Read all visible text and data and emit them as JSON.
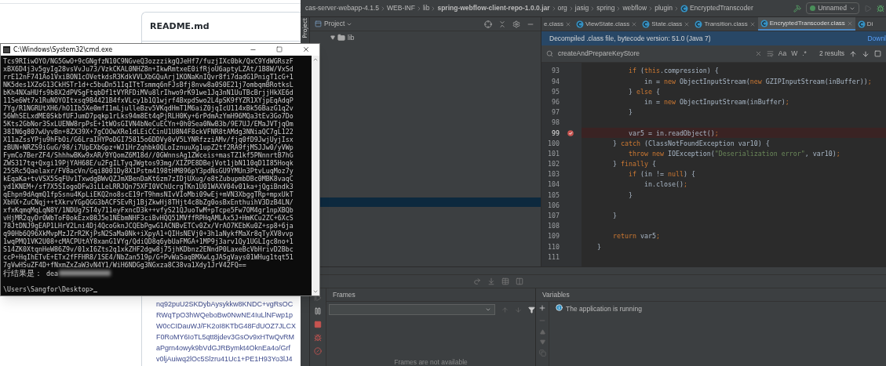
{
  "browser": {
    "file_title": "README.md",
    "content_lines": [
      "nq92puU2SKDybAysykkw8KNDC+vgRsOC",
      "RWqTpO3hWQeboBw0NwNE4IuLlNFwp1p",
      "W0cCIDauWJ/FK2oI8KTbG48FdUOZ7JLCX",
      "F0RoMY6IoTL5qtt8jdev3GsOv9xHTwQvRM",
      "aPgrn4owyk9bVdGJRBymkt4OknEa4o/Grf",
      "v0ljAuiwq2lOc5Slzru41Uc1+PE1H93Yo3lJ4"
    ]
  },
  "cmd": {
    "title": "C:\\Windows\\System32\\cmd.exe",
    "output_lines": [
      "Tcs9RIiwOYO/NG5GwO+9cGNgfzN10C9NGveQ3ozzzikgQJeHf7/fuzjIXc0bk/QxC9YdWGRszF",
      "xBX6D4j3v5gyIg28vsVvJu73/VzkCKAL0NHZ8n+IkwRmtxeE0ifRjoU6aptyLZAt/1B8W/VxSd",
      "rrE12nF741Ao1VxiBON1cOVetkdsR3KdkVVLXbGQuArj1KONaKnIQvr8fi7dadG1PnigT1cG+1",
      "NK5des1XZoG13CkHSTr1d+c5buDn51IqITtTsmmq6nFJsBfj8nvw8a0S0E21j7ombqmBRotksL",
      "bKh4NXaHUfs9b8X2dPVSgFtqbDf1tVYRFDiMVu8lrIhwo9rK91we1Jq3nN1UuTBcBrjjHkXE6d",
      "11Se6Wt7x1RuNOYOItxsq9B4421B4fxVLcy1b1Q1wjrf4BxpdSwo2L4pSK9fYZR1XYjpEqAdqP",
      "7Yg/R1NGRUtXH6/hO1Ib5Xe0mfI1mLjulleBzv5VKqdHmT1M6aiZ0jqIcU114xBk56BazG1q2v",
      "56WhSELxdME0SkbfUFJumD7pqkp1rLks94m8Et4qPjRLH0Ky+6rPdmAzYmH96MQa3tEv3Go7Do",
      "5Kts2GbNor3SxLUENW8rpPsE+1tWOsGIVN4bNeCuECYn+0h0Sea0NwB3b/9E7UJ/EMaJVTjqOm",
      "38IN6g807wUyvBn+8ZX39X+7gCOOwXRe1dLEiCCinU1U8N4F8ckVFNR8tAMdg3NNiaQC7gL122",
      "X11aZssYPju9hFbOi/G6LraIHYPoDGI75815o6DDVy8vV5LYNRfzziAMv/fjq0fD9JwjUyjIsx",
      "zBUN+NRZS9iGuG/98/i7UpEXbGpz+WJ1HrZqhbk0QLoIznuuXg1upZ2tf2RA9fjMSJJw0/yVWp",
      "FymCo7BerZF4/ShhhwBKw9xAR/9YQomZ6M18d//0GWnnsAg1ZWceis+masTZ1kf5PNnnrtB7hG",
      "ZWS317tq+Qxgi19PjYAH68E/u2FgILTyqJWgtos93mg/XIZPE8DBejVot1jbN110qD1I85Hoqk",
      "25SRc5Qaelaxr/FV8acVn/Gqi8001Dy8X1Pstm4198tHM896pY3pdNsGU9YMUn3PtvLuqMoz7y",
      "kEqaKa+tvVSX5SqFUv1TxwdgBWvQZJmXBenDaKt6zm7zIDjUXug/e8tZubupmbDBc0MBK8vaqC",
      "yd1KNEM+/sf7X5SIogoDFw3iLLeLRRJQn75XFI0VChUcrgTKn1U01WAXV04v01ka+jQgiBndk3",
      "qEhpn9dAqmQ1fpSsnu4KpLiEKQ2no8scE19rT9hmsNIvVIoMbi09wEj+mVN3XbggTRp+mpxUkT",
      "XbHX+ZuCNqj++tXkrvYGpQGG3bACFSEvRj1BjZkwHj8THjt4c8bZg0osBxEnthuihV3DzB4LN/",
      "xfxKqmqMqLqN8Y/1NDUg7ST4y711eyFxncD3k++vfyS21QJuoTwM+pTcpe5Fw7OM4gr1npXBQb",
      "vHjMR2qyDrOWbToF0okEzx08J5e1NEbmNHF3ciBvHQQ51MVffRPHqAMLAx5J+HmKCu2ZC+6XcS",
      "78JtDNJ9gEAP1LHrV2Lni4Dj4QcoGknJCQEbPgwG1ACNBvETCv0Zx/VrAO7KEbKu0Z+sp8+6ja",
      "q90Hb6Q96XkMvpMzJZrR2KjPsN2SaMa0Nk+iXpyA1+QIHsNEVj0+3h1aNykfMaXr8qTyXV8vvp",
      "1wqPMQ1VK2U08+cMACPUtAY8xanG1VYg/QdiQD8q6ybUaFMGA+1MP9j3arv1Qy1UGLIgc8no+1",
      "S14ZK0XtqnHeW86Z9v/01xI6Zts2q1xkZHF2dgw8j75jhKDbnz2ENndP0LaxeBcVbHrivD2Bbc",
      "ccP+HqIhETvE+ETx2fFFHR8/1SE4/NbZan519p/G+PvWaSaqBMXwLgJASgVays01WHug1tqt51",
      "7gVwHSuZF4D+fNxmZxZaW3vN4Y1/WiH6NDGg3NGxza8C38va1Xdy1JrV42FQ=="
    ],
    "result": {
      "label": "行结果是：",
      "value": "dea"
    },
    "prompt": "\\Users\\Sangfor\\Desktop>"
  },
  "ide": {
    "breadcrumbs": [
      {
        "label": "cas-server-webapp-4.1.5",
        "kind": "module"
      },
      {
        "label": "WEB-INF",
        "kind": "folder"
      },
      {
        "label": "lib",
        "kind": "folder"
      },
      {
        "label": "spring-webflow-client-repo-1.0.0.jar",
        "kind": "jar"
      },
      {
        "label": "org",
        "kind": "folder"
      },
      {
        "label": "jasig",
        "kind": "folder"
      },
      {
        "label": "spring",
        "kind": "folder"
      },
      {
        "label": "webflow",
        "kind": "folder"
      },
      {
        "label": "plugin",
        "kind": "folder"
      },
      {
        "label": "EncryptedTranscoder",
        "kind": "class"
      }
    ],
    "run_config": "Unnamed",
    "project_panel": {
      "side_tab": "Project",
      "title": "Project",
      "tree": [
        {
          "label": "lib",
          "expanded": true
        }
      ]
    },
    "tabs": [
      {
        "label": "e.class",
        "kind": "plain",
        "selected": false
      },
      {
        "label": "ViewState.class",
        "kind": "class",
        "selected": false
      },
      {
        "label": "State.class",
        "kind": "class",
        "selected": false
      },
      {
        "label": "Transition.class",
        "kind": "class",
        "selected": false
      },
      {
        "label": "EncryptedTranscoder.class",
        "kind": "class",
        "selected": true
      },
      {
        "label": "Di",
        "kind": "cut",
        "selected": false
      }
    ],
    "banner": {
      "text": "Decompiled .class file, bytecode version: 51.0 (Java 7)",
      "link": "Downl"
    },
    "search": {
      "value": "createAndPrepareKeyStore",
      "toggles": [
        "Aa",
        "W",
        ".*"
      ],
      "results": "2 results"
    },
    "code_lines": [
      {
        "number": "93",
        "breakpoint": false,
        "tokens": [
          {
            "kind": "keyword",
            "text": "            if"
          },
          {
            "kind": "plain",
            "text": " ("
          },
          {
            "kind": "keyword",
            "text": "this"
          },
          {
            "kind": "plain",
            "text": ".compression) {"
          }
        ]
      },
      {
        "number": "94",
        "breakpoint": false,
        "tokens": [
          {
            "kind": "plain",
            "text": "                in = "
          },
          {
            "kind": "keyword",
            "text": "new"
          },
          {
            "kind": "plain",
            "text": " ObjectInputStream("
          },
          {
            "kind": "keyword",
            "text": "new"
          },
          {
            "kind": "plain",
            "text": " GZIPInputStream(inBuffer))"
          },
          {
            "kind": "keyword",
            "text": ";"
          }
        ]
      },
      {
        "number": "95",
        "breakpoint": false,
        "tokens": [
          {
            "kind": "plain",
            "text": "            } "
          },
          {
            "kind": "keyword",
            "text": "else"
          },
          {
            "kind": "plain",
            "text": " {"
          }
        ]
      },
      {
        "number": "96",
        "breakpoint": false,
        "tokens": [
          {
            "kind": "plain",
            "text": "                in = "
          },
          {
            "kind": "keyword",
            "text": "new"
          },
          {
            "kind": "plain",
            "text": " ObjectInputStream(inBuffer)"
          },
          {
            "kind": "keyword",
            "text": ";"
          }
        ]
      },
      {
        "number": "97",
        "breakpoint": false,
        "tokens": [
          {
            "kind": "plain",
            "text": "            }"
          }
        ]
      },
      {
        "number": "98",
        "breakpoint": false
      },
      {
        "number": "99",
        "breakpoint": true,
        "tokens": [
          {
            "kind": "plain",
            "text": "            var5 = in.readObject()"
          },
          {
            "kind": "keyword",
            "text": ";"
          }
        ]
      },
      {
        "number": "100",
        "breakpoint": false,
        "tokens": [
          {
            "kind": "plain",
            "text": "        } "
          },
          {
            "kind": "keyword",
            "text": "catch"
          },
          {
            "kind": "plain",
            "text": " (ClassNotFoundException var10) {"
          }
        ]
      },
      {
        "number": "101",
        "breakpoint": false,
        "tokens": [
          {
            "kind": "keyword",
            "text": "            throw new"
          },
          {
            "kind": "plain",
            "text": " IOException("
          },
          {
            "kind": "string",
            "text": "\"Deserialization error\""
          },
          {
            "kind": "plain",
            "text": ", var10)"
          },
          {
            "kind": "keyword",
            "text": ";"
          }
        ]
      },
      {
        "number": "102",
        "breakpoint": false,
        "tokens": [
          {
            "kind": "plain",
            "text": "        } "
          },
          {
            "kind": "keyword",
            "text": "finally"
          },
          {
            "kind": "plain",
            "text": " {"
          }
        ]
      },
      {
        "number": "103",
        "breakpoint": false,
        "tokens": [
          {
            "kind": "keyword",
            "text": "            if"
          },
          {
            "kind": "plain",
            "text": " (in != "
          },
          {
            "kind": "keyword",
            "text": "null"
          },
          {
            "kind": "plain",
            "text": ") {"
          }
        ]
      },
      {
        "number": "104",
        "breakpoint": false,
        "tokens": [
          {
            "kind": "plain",
            "text": "                in.close()"
          },
          {
            "kind": "keyword",
            "text": ";"
          }
        ]
      },
      {
        "number": "105",
        "breakpoint": false,
        "tokens": [
          {
            "kind": "plain",
            "text": "            }"
          }
        ]
      },
      {
        "number": "106",
        "breakpoint": false
      },
      {
        "number": "107",
        "breakpoint": false,
        "tokens": [
          {
            "kind": "plain",
            "text": "        }"
          }
        ]
      },
      {
        "number": "108",
        "breakpoint": false
      },
      {
        "number": "109",
        "breakpoint": false,
        "tokens": [
          {
            "kind": "keyword",
            "text": "        return"
          },
          {
            "kind": "plain",
            "text": " var5"
          },
          {
            "kind": "keyword",
            "text": ";"
          }
        ]
      },
      {
        "number": "110",
        "breakpoint": false,
        "tokens": [
          {
            "kind": "plain",
            "text": "    }"
          }
        ]
      },
      {
        "number": "111",
        "breakpoint": false
      }
    ],
    "debugger": {
      "frames_title": "Frames",
      "variables_title": "Variables",
      "status": "The application is running",
      "frames_empty": "Frames are not available"
    }
  }
}
